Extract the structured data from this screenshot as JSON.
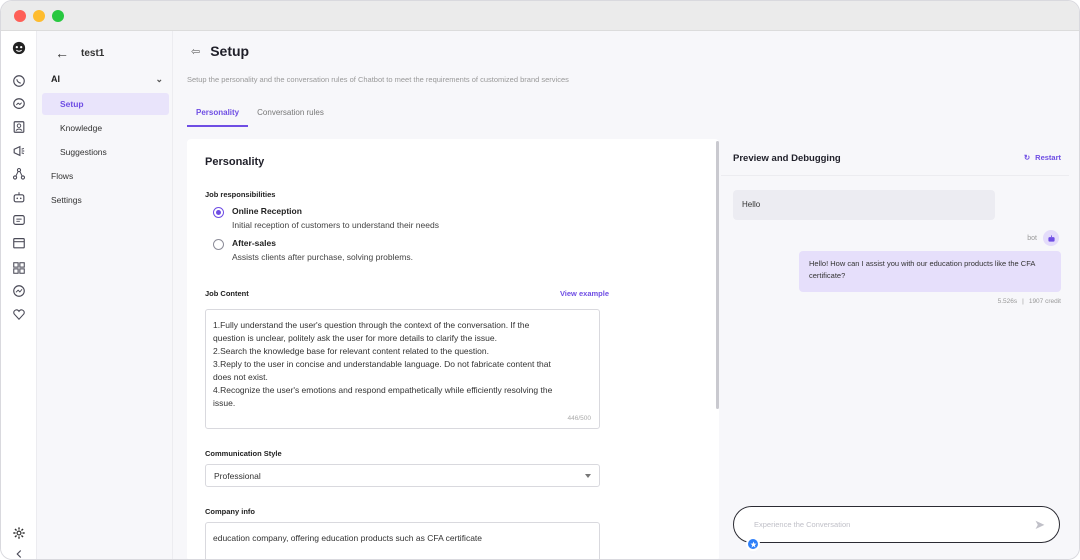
{
  "sidebar": {
    "app_name": "test1",
    "section": "AI",
    "items": [
      {
        "label": "Setup"
      },
      {
        "label": "Knowledge"
      },
      {
        "label": "Suggestions"
      }
    ],
    "flows": "Flows",
    "settings": "Settings"
  },
  "rail_icons": [
    "logo-icon",
    "whatsapp-icon",
    "messenger-icon",
    "contacts-icon",
    "megaphone-icon",
    "flows-icon",
    "bot-icon",
    "chat-widget-icon",
    "calendar-icon",
    "apps-icon",
    "analytics-icon",
    "integrations-icon",
    "settings-icon",
    "collapse-icon"
  ],
  "header": {
    "title": "Setup",
    "subtitle": "Setup the personality and the conversation rules of Chatbot to meet the requirements of customized brand services",
    "tabs": [
      {
        "label": "Personality",
        "active": true
      },
      {
        "label": "Conversation rules",
        "active": false
      }
    ]
  },
  "personality": {
    "heading": "Personality",
    "job_label": "Job responsibilities",
    "options": [
      {
        "title": "Online Reception",
        "desc": "Initial reception of customers to understand their needs",
        "selected": true
      },
      {
        "title": "After-sales",
        "desc": "Assists clients after purchase, solving problems.",
        "selected": false
      }
    ],
    "content_label": "Job Content",
    "view_example": "View example",
    "content_lines": [
      "1.Fully understand the user's question through the context of the conversation. If the",
      "question is unclear, politely ask the user for more details to clarify the issue.",
      "2.Search the knowledge base for relevant content related to the question.",
      "3.Reply to the user in concise and understandable language. Do not fabricate content that",
      "does not exist.",
      "4.Recognize the user's emotions and respond empathetically while efficiently resolving the",
      "issue."
    ],
    "counter": "446/500",
    "style_label": "Communication Style",
    "style_value": "Professional",
    "company_label": "Company info",
    "company_value": "education company, offering education products such as CFA certificate"
  },
  "preview": {
    "title": "Preview and Debugging",
    "restart": "Restart",
    "user_msg": "Hello",
    "bot_name": "bot",
    "bot_msg": "Hello! How can I assist you with our education products like the CFA certificate?",
    "time": "5.526s",
    "sep": "|",
    "credit": "1907 credit",
    "input_placeholder": "Experience the Conversation"
  },
  "colors": {
    "accent": "#6f4ee4",
    "accent_light": "#e6dffb"
  }
}
